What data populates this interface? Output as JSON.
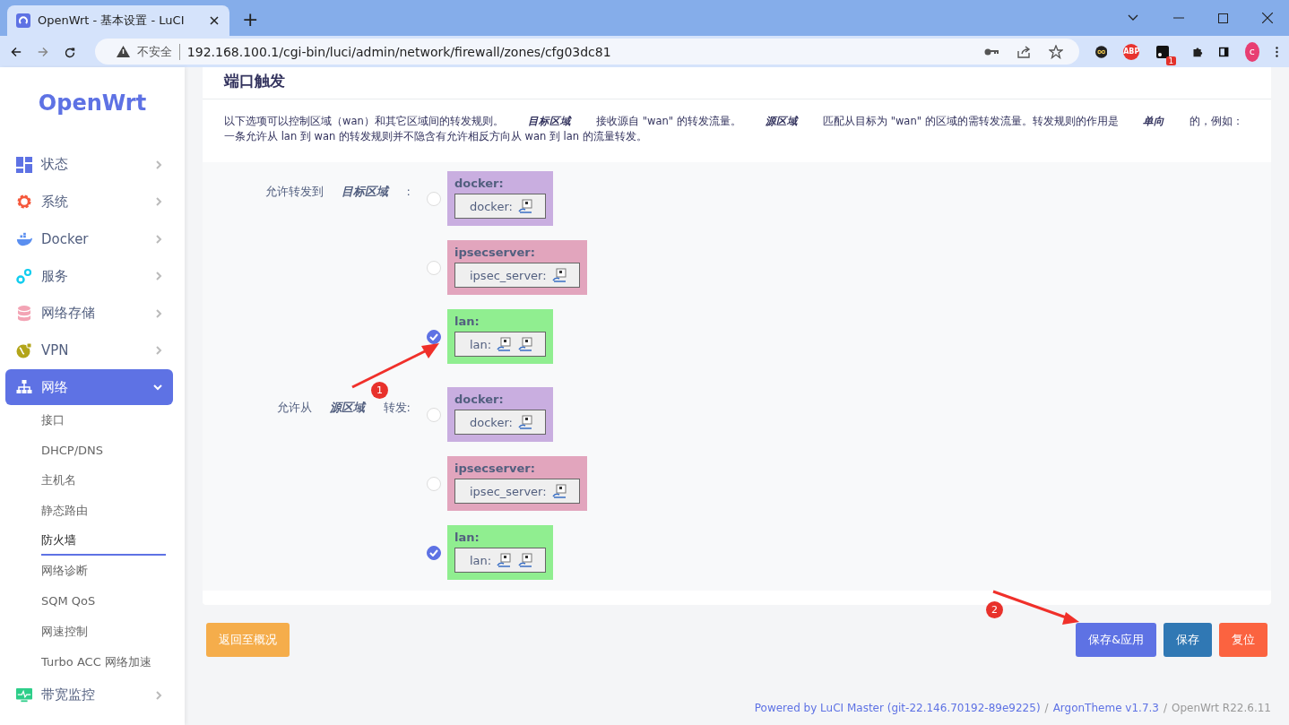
{
  "browser": {
    "tab_title": "OpenWrt - 基本设置 - LuCI",
    "new_tab": "+",
    "security": "不安全",
    "url": "192.168.100.1/cgi-bin/luci/admin/network/firewall/zones/cfg03dc81",
    "extensions": [
      {
        "kind": "infinity"
      },
      {
        "kind": "abp",
        "label": "ABP"
      },
      {
        "kind": "app",
        "badge": "1"
      },
      {
        "kind": "puzzle"
      },
      {
        "kind": "sidebar"
      }
    ],
    "profile": "c"
  },
  "sidebar": {
    "logo": "OpenWrt",
    "items": [
      {
        "label": "状态",
        "kind": "dashboard",
        "selected": false,
        "expanded": false
      },
      {
        "label": "系统",
        "kind": "gear",
        "selected": false,
        "expanded": false
      },
      {
        "label": "Docker",
        "kind": "whale",
        "selected": false,
        "expanded": false
      },
      {
        "label": "服务",
        "kind": "gears",
        "selected": false,
        "expanded": false
      },
      {
        "label": "网络存储",
        "kind": "database",
        "selected": false,
        "expanded": false
      },
      {
        "label": "VPN",
        "kind": "globe",
        "selected": false,
        "expanded": false
      },
      {
        "label": "网络",
        "kind": "sitemap",
        "selected": true,
        "expanded": true,
        "children": [
          {
            "label": "接口",
            "selected": false
          },
          {
            "label": "DHCP/DNS",
            "selected": false
          },
          {
            "label": "主机名",
            "selected": false
          },
          {
            "label": "静态路由",
            "selected": false
          },
          {
            "label": "防火墙",
            "selected": true
          },
          {
            "label": "网络诊断",
            "selected": false
          },
          {
            "label": "SQM QoS",
            "selected": false
          },
          {
            "label": "网速控制",
            "selected": false
          },
          {
            "label": "Turbo ACC 网络加速",
            "selected": false
          }
        ]
      },
      {
        "label": "带宽监控",
        "kind": "monitor",
        "selected": false,
        "expanded": false
      }
    ]
  },
  "section": {
    "title": "端口触发",
    "description": "以下选项可以控制区域（wan）和其它区域间的转发规则。 *目标区域* 接收源自 \"wan\" 的转发流量。 *源区域* 匹配从目标为 \"wan\" 的区域的需转发流量。转发规则的作用是 *单向* 的，例如：一条允许从 lan 到 wan 的转发规则并不隐含有允许相反方向从 wan 到 lan 的流量转发。",
    "groups": [
      {
        "label": "允许转发到 *目标区域* :",
        "zones": [
          {
            "name": "docker:",
            "color": "#c9aee0",
            "checked": false,
            "networks": "docker:",
            "devices": [
              {
                "kind": "computer"
              }
            ]
          },
          {
            "name": "ipsecserver:",
            "color": "#e2a5bd",
            "checked": false,
            "networks": "ipsec_server:",
            "devices": [
              {
                "kind": "computer"
              }
            ]
          },
          {
            "name": "lan:",
            "color": "#90ee90",
            "checked": true,
            "networks": "lan:",
            "devices": [
              {
                "kind": "computer"
              },
              {
                "kind": "computer"
              }
            ]
          }
        ]
      },
      {
        "label": "允许从 *源区域* 转发:",
        "zones": [
          {
            "name": "docker:",
            "color": "#c9aee0",
            "checked": false,
            "networks": "docker:",
            "devices": [
              {
                "kind": "computer"
              }
            ]
          },
          {
            "name": "ipsecserver:",
            "color": "#e2a5bd",
            "checked": false,
            "networks": "ipsec_server:",
            "devices": [
              {
                "kind": "computer"
              }
            ]
          },
          {
            "name": "lan:",
            "color": "#90ee90",
            "checked": true,
            "networks": "lan:",
            "devices": [
              {
                "kind": "computer"
              },
              {
                "kind": "computer"
              }
            ]
          }
        ]
      }
    ]
  },
  "buttons": [
    {
      "label": "返回至概况",
      "kind": "back"
    },
    {
      "label": "保存&应用",
      "kind": "apply"
    },
    {
      "label": "保存",
      "kind": "save"
    },
    {
      "label": "复位",
      "kind": "reset"
    }
  ],
  "footer": [
    {
      "text": "Powered by LuCI Master (git-22.146.70192-89e9225)",
      "kind": "link"
    },
    {
      "text": "/",
      "kind": "plain"
    },
    {
      "text": "ArgonTheme v1.7.3",
      "kind": "link"
    },
    {
      "text": "/",
      "kind": "plain"
    },
    {
      "text": "OpenWrt R22.6.11",
      "kind": "plain"
    }
  ],
  "annotations": [
    {
      "label": "1"
    },
    {
      "label": "2"
    }
  ]
}
